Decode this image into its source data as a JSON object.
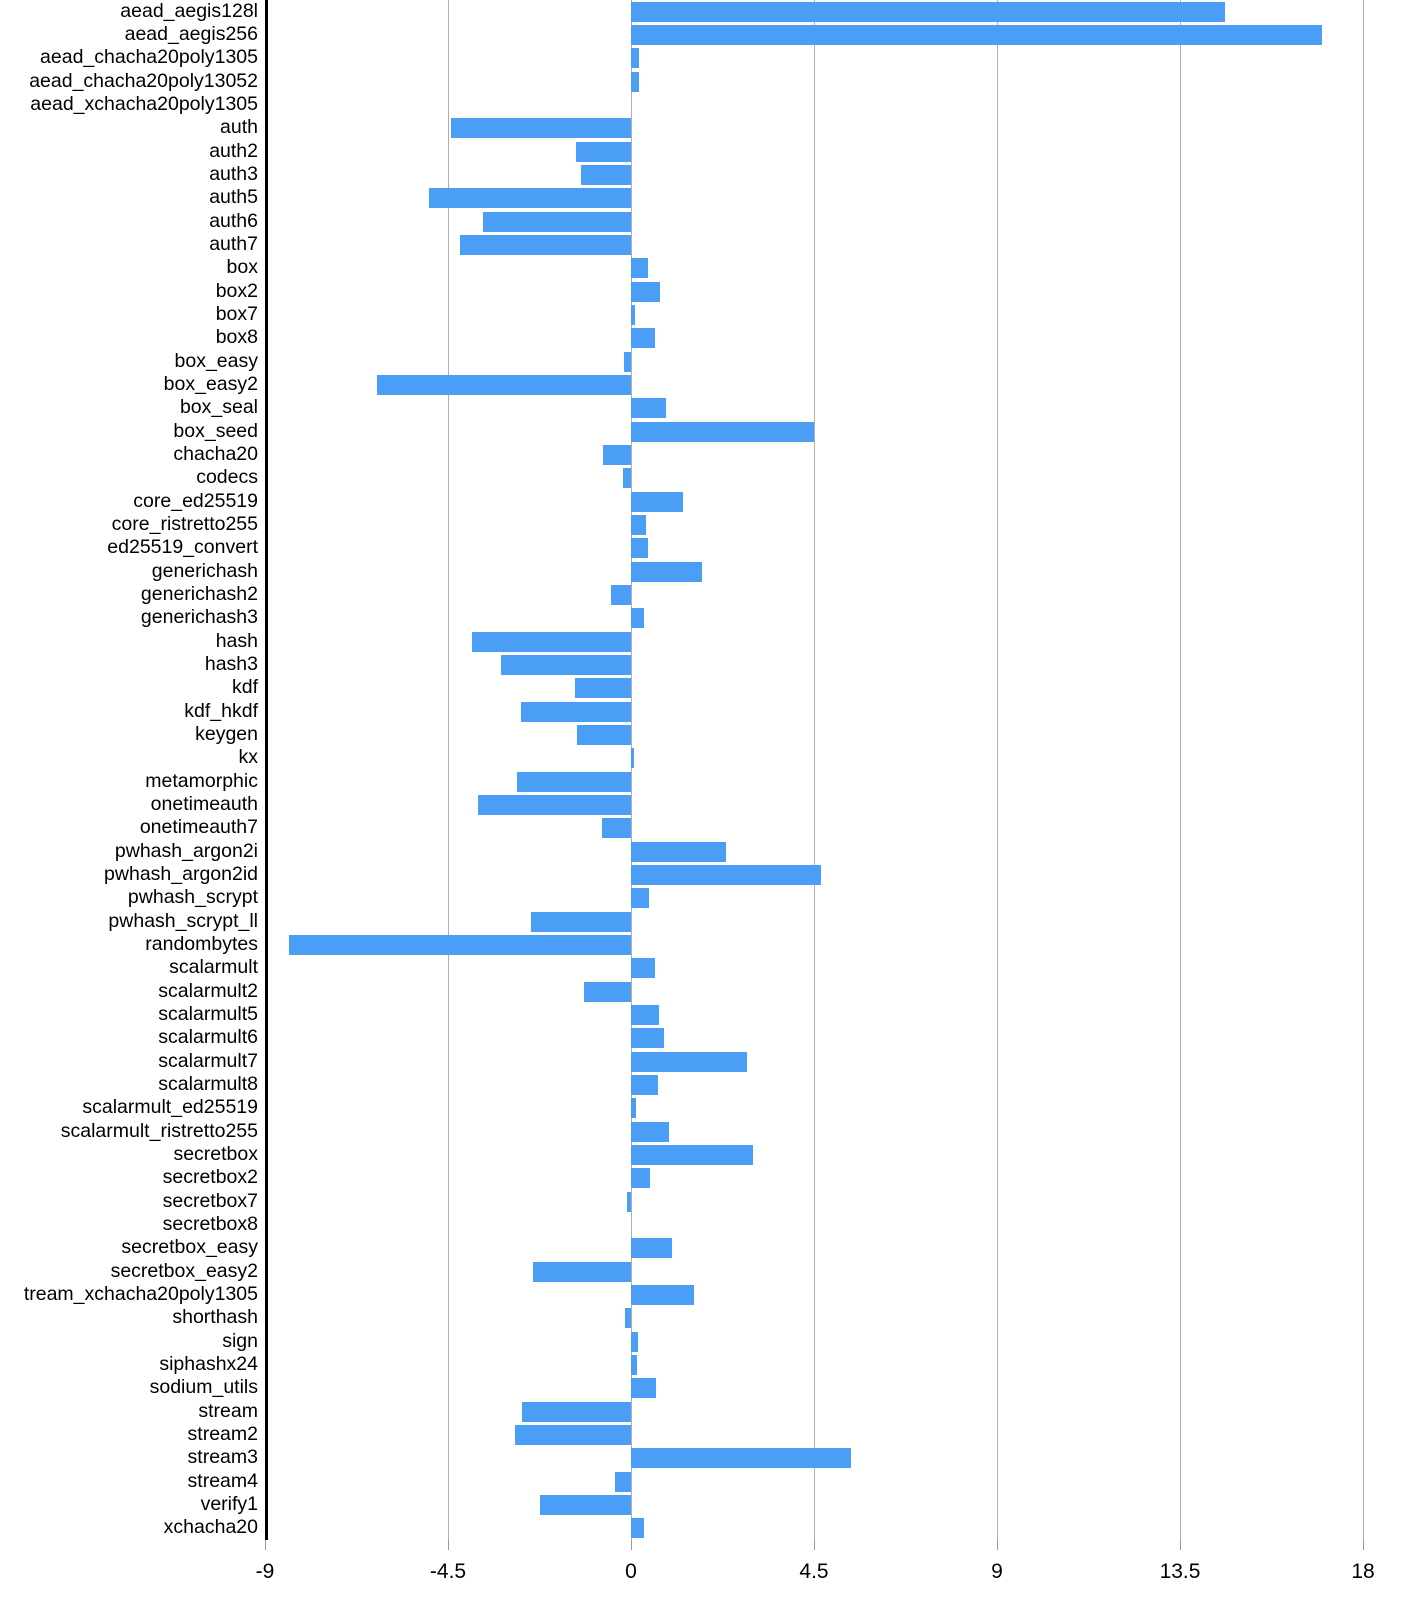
{
  "chart_data": {
    "type": "bar",
    "orientation": "horizontal",
    "title": "",
    "xlabel": "",
    "ylabel": "",
    "xlim": [
      -9,
      18
    ],
    "xticks": [
      "-9",
      "-4.5",
      "0",
      "4.5",
      "9",
      "13.5",
      "18"
    ],
    "xtick_values": [
      -9,
      -4.5,
      0,
      4.5,
      9,
      13.5,
      18
    ],
    "grid": true,
    "legend": "none",
    "bar_color": "#4a9ef5",
    "categories": [
      "aead_aegis128l",
      "aead_aegis256",
      "aead_chacha20poly1305",
      "aead_chacha20poly13052",
      "aead_xchacha20poly1305",
      "auth",
      "auth2",
      "auth3",
      "auth5",
      "auth6",
      "auth7",
      "box",
      "box2",
      "box7",
      "box8",
      "box_easy",
      "box_easy2",
      "box_seal",
      "box_seed",
      "chacha20",
      "codecs",
      "core_ed25519",
      "core_ristretto255",
      "ed25519_convert",
      "generichash",
      "generichash2",
      "generichash3",
      "hash",
      "hash3",
      "kdf",
      "kdf_hkdf",
      "keygen",
      "kx",
      "metamorphic",
      "onetimeauth",
      "onetimeauth7",
      "pwhash_argon2i",
      "pwhash_argon2id",
      "pwhash_scrypt",
      "pwhash_scrypt_ll",
      "randombytes",
      "scalarmult",
      "scalarmult2",
      "scalarmult5",
      "scalarmult6",
      "scalarmult7",
      "scalarmult8",
      "scalarmult_ed25519",
      "scalarmult_ristretto255",
      "secretbox",
      "secretbox2",
      "secretbox7",
      "secretbox8",
      "secretbox_easy",
      "secretbox_easy2",
      "tream_xchacha20poly1305",
      "shorthash",
      "sign",
      "siphashx24",
      "sodium_utils",
      "stream",
      "stream2",
      "stream3",
      "stream4",
      "verify1",
      "xchacha20"
    ],
    "values": [
      14.6,
      17.0,
      0.2,
      0.2,
      0.0,
      -4.43,
      -1.35,
      -1.23,
      -4.97,
      -3.64,
      -4.2,
      0.42,
      0.72,
      0.1,
      0.58,
      -0.17,
      -6.25,
      0.86,
      4.5,
      -0.69,
      -0.2,
      1.27,
      0.37,
      0.42,
      1.74,
      -0.49,
      0.32,
      -3.91,
      -3.2,
      -1.37,
      -2.71,
      -1.34,
      0.07,
      -2.81,
      -3.77,
      -0.72,
      2.34,
      4.67,
      0.44,
      -2.46,
      -8.41,
      0.6,
      -1.15,
      0.68,
      0.82,
      2.86,
      0.66,
      0.12,
      0.93,
      3.01,
      0.46,
      -0.1,
      0.0,
      1.0,
      -2.42,
      1.54,
      -0.15,
      0.17,
      0.15,
      0.61,
      -2.69,
      -2.86,
      5.4,
      -0.39,
      -2.23,
      0.33
    ]
  }
}
